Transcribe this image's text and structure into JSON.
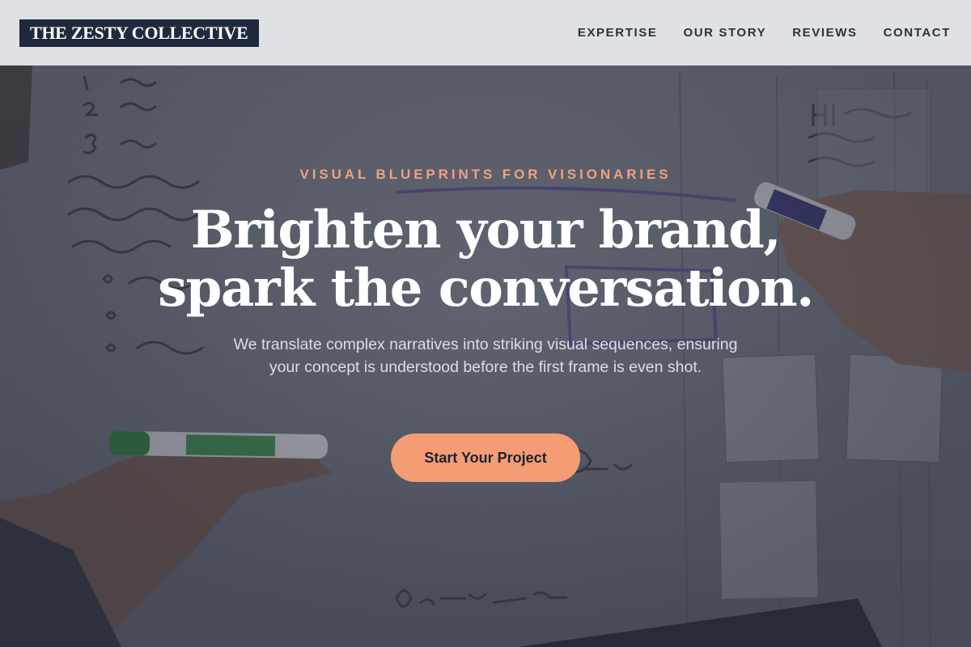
{
  "header": {
    "logo_text": "THE ZESTY COLLECTIVE",
    "nav": [
      {
        "label": "EXPERTISE"
      },
      {
        "label": "OUR STORY"
      },
      {
        "label": "REVIEWS"
      },
      {
        "label": "CONTACT"
      }
    ]
  },
  "hero": {
    "eyebrow": "VISUAL BLUEPRINTS FOR VISIONARIES",
    "headline_line1": "Brighten your brand,",
    "headline_line2": "spark the conversation.",
    "subtext": "We translate complex narratives into striking visual sequences, ensuring your concept is understood before the first frame is even shot.",
    "cta_label": "Start Your Project"
  },
  "colors": {
    "header_bg": "#e9eaec",
    "logo_bg": "#1f2a3d",
    "accent": "#f49c74",
    "eyebrow": "#f4a17c",
    "headline": "#ffffff"
  }
}
